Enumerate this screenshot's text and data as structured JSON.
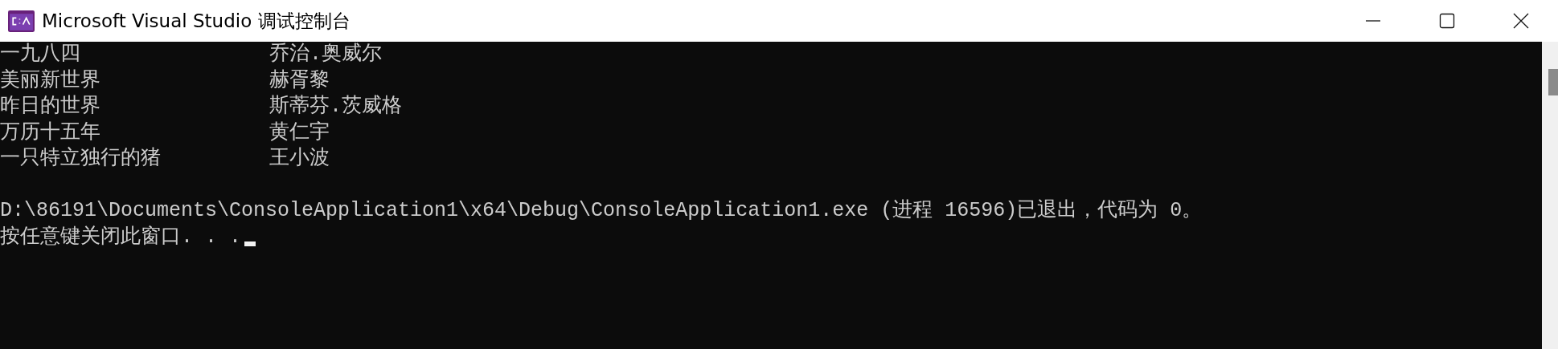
{
  "window": {
    "title": "Microsoft Visual Studio 调试控制台"
  },
  "console": {
    "rows": [
      {
        "title": "一九八四",
        "author": "乔治.奥威尔"
      },
      {
        "title": "美丽新世界",
        "author": "赫胥黎"
      },
      {
        "title": "昨日的世界",
        "author": "斯蒂芬.茨威格"
      },
      {
        "title": "万历十五年",
        "author": "黄仁宇"
      },
      {
        "title": "一只特立独行的猪",
        "author": "王小波"
      }
    ],
    "exit_message": "D:\\86191\\Documents\\ConsoleApplication1\\x64\\Debug\\ConsoleApplication1.exe (进程 16596)已退出，代码为 0。",
    "prompt": "按任意键关闭此窗口. . .",
    "cursor_visible": true
  }
}
